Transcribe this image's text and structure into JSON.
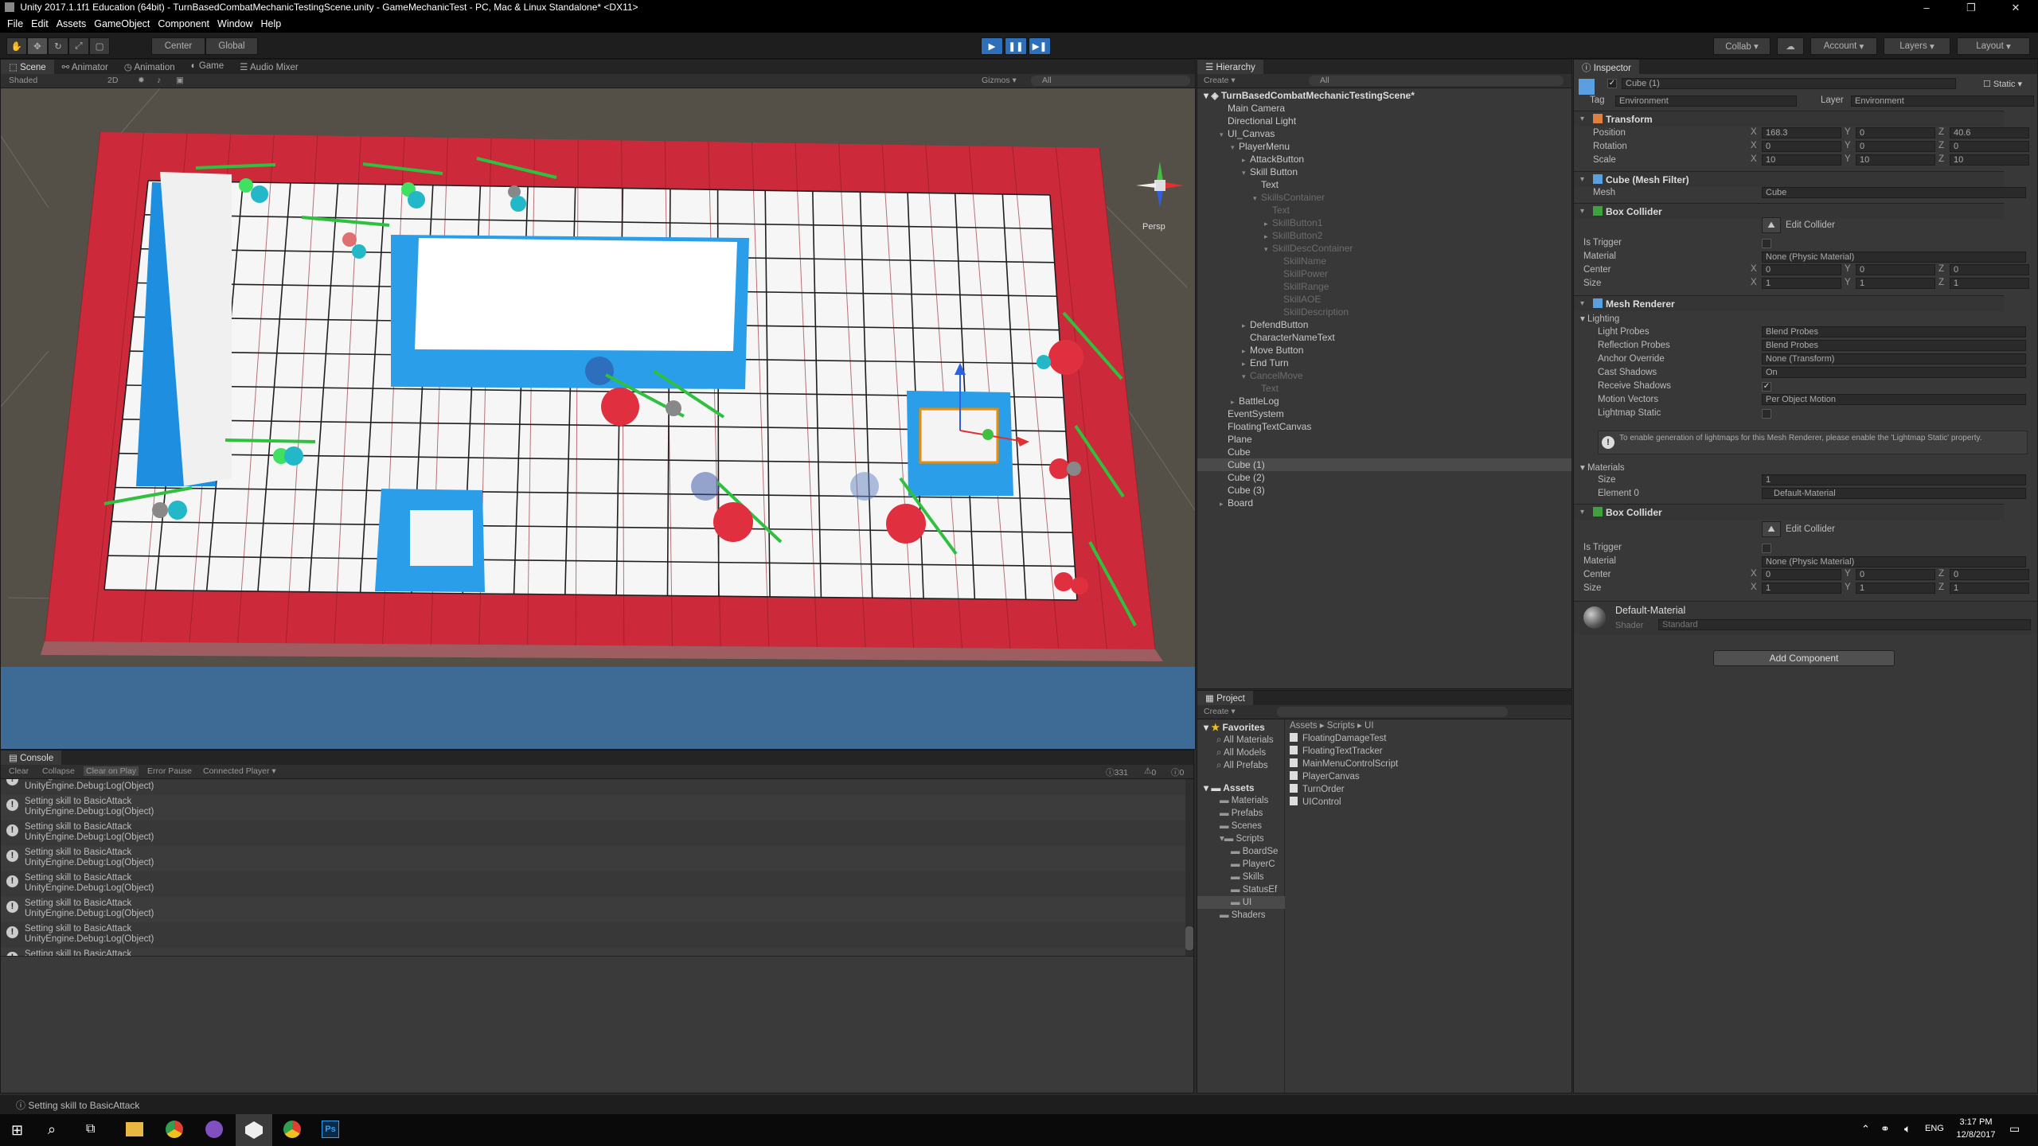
{
  "window": {
    "title": "Unity 2017.1.1f1 Education (64bit) - TurnBasedCombatMechanicTestingScene.unity - GameMechanicTest - PC, Mac & Linux Standalone* <DX11>",
    "controls": [
      "–",
      "❐",
      "✕"
    ]
  },
  "menu": [
    "File",
    "Edit",
    "Assets",
    "GameObject",
    "Component",
    "Window",
    "Help"
  ],
  "toolbar": {
    "center": "Center",
    "global": "Global",
    "collab": "Collab ▾",
    "account": "Account",
    "layers": "Layers",
    "layout": "Layout"
  },
  "scene": {
    "tabs": [
      "Scene",
      "Animator",
      "Animation",
      "Game",
      "Audio Mixer"
    ],
    "shading": "Shaded",
    "mode_2d": "2D",
    "gizmos": "Gizmos ▾",
    "search_placeholder": "All",
    "persp": "Persp"
  },
  "console": {
    "tab": "Console",
    "buttons": [
      "Clear",
      "Collapse",
      "Clear on Play",
      "Error Pause",
      "Connected Player ▾"
    ],
    "counts": {
      "logs": "331",
      "warnings": "0",
      "errors": "0"
    },
    "entries": [
      {
        "line1": "Setting skill to BasicAttack",
        "line2": "UnityEngine.Debug:Log(Object)"
      },
      {
        "line1": "Setting skill to BasicAttack",
        "line2": "UnityEngine.Debug:Log(Object)"
      },
      {
        "line1": "Setting skill to BasicAttack",
        "line2": "UnityEngine.Debug:Log(Object)"
      },
      {
        "line1": "Setting skill to BasicAttack",
        "line2": "UnityEngine.Debug:Log(Object)"
      },
      {
        "line1": "Setting skill to BasicAttack",
        "line2": "UnityEngine.Debug:Log(Object)"
      },
      {
        "line1": "Setting skill to BasicAttack",
        "line2": "UnityEngine.Debug:Log(Object)"
      },
      {
        "line1": "Setting skill to BasicAttack",
        "line2": "UnityEngine.Debug:Log(Object)"
      },
      {
        "line1": "Setting skill to BasicAttack",
        "line2": "UnityEngine.Debug:Log(Object)"
      },
      {
        "line1": "Setting skill to BasicAttack",
        "line2": "UnityEngine.Debug:Log(Object)"
      }
    ]
  },
  "hierarchy": {
    "tab": "Hierarchy",
    "create": "Create ▾",
    "search_placeholder": "All",
    "scene_name": "TurnBasedCombatMechanicTestingScene*",
    "items": [
      {
        "label": "Main Camera",
        "depth": 1,
        "state": "normal"
      },
      {
        "label": "Directional Light",
        "depth": 1,
        "state": "normal"
      },
      {
        "label": "UI_Canvas",
        "depth": 1,
        "state": "open"
      },
      {
        "label": "PlayerMenu",
        "depth": 2,
        "state": "open"
      },
      {
        "label": "AttackButton",
        "depth": 3,
        "state": "closed"
      },
      {
        "label": "Skill Button",
        "depth": 3,
        "state": "open"
      },
      {
        "label": "Text",
        "depth": 4,
        "state": "normal"
      },
      {
        "label": "SkillsContainer",
        "depth": 4,
        "state": "open-dim"
      },
      {
        "label": "Text",
        "depth": 5,
        "state": "dim"
      },
      {
        "label": "SkillButton1",
        "depth": 5,
        "state": "closed-dim"
      },
      {
        "label": "SkillButton2",
        "depth": 5,
        "state": "closed-dim"
      },
      {
        "label": "SkillDescContainer",
        "depth": 5,
        "state": "open-dim"
      },
      {
        "label": "SkillName",
        "depth": 6,
        "state": "dim"
      },
      {
        "label": "SkillPower",
        "depth": 6,
        "state": "dim"
      },
      {
        "label": "SkillRange",
        "depth": 6,
        "state": "dim"
      },
      {
        "label": "SkillAOE",
        "depth": 6,
        "state": "dim"
      },
      {
        "label": "SkillDescription",
        "depth": 6,
        "state": "dim"
      },
      {
        "label": "DefendButton",
        "depth": 3,
        "state": "closed"
      },
      {
        "label": "CharacterNameText",
        "depth": 3,
        "state": "normal"
      },
      {
        "label": "Move Button",
        "depth": 3,
        "state": "closed"
      },
      {
        "label": "End Turn",
        "depth": 3,
        "state": "closed"
      },
      {
        "label": "CancelMove",
        "depth": 3,
        "state": "open-dim"
      },
      {
        "label": "Text",
        "depth": 4,
        "state": "dim"
      },
      {
        "label": "BattleLog",
        "depth": 2,
        "state": "closed"
      },
      {
        "label": "EventSystem",
        "depth": 1,
        "state": "normal"
      },
      {
        "label": "FloatingTextCanvas",
        "depth": 1,
        "state": "normal"
      },
      {
        "label": "Plane",
        "depth": 1,
        "state": "normal"
      },
      {
        "label": "Cube",
        "depth": 1,
        "state": "normal"
      },
      {
        "label": "Cube (1)",
        "depth": 1,
        "state": "selected"
      },
      {
        "label": "Cube (2)",
        "depth": 1,
        "state": "normal"
      },
      {
        "label": "Cube (3)",
        "depth": 1,
        "state": "normal"
      },
      {
        "label": "Board",
        "depth": 1,
        "state": "closed"
      }
    ]
  },
  "project": {
    "tab": "Project",
    "create": "Create ▾",
    "breadcrumb": [
      "Assets",
      "Scripts",
      "UI"
    ],
    "favorites_label": "Favorites",
    "favorites": [
      "All Materials",
      "All Models",
      "All Prefabs"
    ],
    "assets_label": "Assets",
    "folders": [
      {
        "label": "Materials",
        "depth": 1
      },
      {
        "label": "Prefabs",
        "depth": 1
      },
      {
        "label": "Scenes",
        "depth": 1
      },
      {
        "label": "Scripts",
        "depth": 1
      },
      {
        "label": "BoardSe",
        "depth": 2
      },
      {
        "label": "PlayerC",
        "depth": 2
      },
      {
        "label": "Skills",
        "depth": 2
      },
      {
        "label": "StatusEf",
        "depth": 2
      },
      {
        "label": "UI",
        "depth": 2
      },
      {
        "label": "Shaders",
        "depth": 1
      }
    ],
    "files": [
      "FloatingDamageTest",
      "FloatingTextTracker",
      "MainMenuControlScript",
      "PlayerCanvas",
      "TurnOrder",
      "UIControl"
    ]
  },
  "inspector": {
    "tab": "Inspector",
    "object_name": "Cube (1)",
    "static_label": "Static ▾",
    "tag_label": "Tag",
    "tag_value": "Environment",
    "layer_label": "Layer",
    "layer_value": "Environment",
    "transform": {
      "title": "Transform",
      "position": {
        "label": "Position",
        "x": "168.3",
        "y": "0",
        "z": "40.6"
      },
      "rotation": {
        "label": "Rotation",
        "x": "0",
        "y": "0",
        "z": "0"
      },
      "scale": {
        "label": "Scale",
        "x": "10",
        "y": "10",
        "z": "10"
      }
    },
    "mesh_filter": {
      "title": "Cube (Mesh Filter)",
      "mesh_label": "Mesh",
      "mesh_value": "Cube"
    },
    "box_collider_1": {
      "title": "Box Collider",
      "edit": "Edit Collider",
      "is_trigger": "Is Trigger",
      "material_label": "Material",
      "material_value": "None (Physic Material)",
      "center": {
        "label": "Center",
        "x": "0",
        "y": "0",
        "z": "0"
      },
      "size": {
        "label": "Size",
        "x": "1",
        "y": "1",
        "z": "1"
      }
    },
    "mesh_renderer": {
      "title": "Mesh Renderer",
      "lighting": "Lighting",
      "light_probes": {
        "label": "Light Probes",
        "value": "Blend Probes"
      },
      "reflection_probes": {
        "label": "Reflection Probes",
        "value": "Blend Probes"
      },
      "anchor_override": {
        "label": "Anchor Override",
        "value": "None (Transform)"
      },
      "cast_shadows": {
        "label": "Cast Shadows",
        "value": "On"
      },
      "receive_shadows": "Receive Shadows",
      "motion_vectors": {
        "label": "Motion Vectors",
        "value": "Per Object Motion"
      },
      "lightmap_static": "Lightmap Static",
      "info": "To enable generation of lightmaps for this Mesh Renderer, please enable the 'Lightmap Static' property.",
      "materials": "Materials",
      "size": {
        "label": "Size",
        "value": "1"
      },
      "element0": {
        "label": "Element 0",
        "value": "Default-Material"
      }
    },
    "box_collider_2": {
      "title": "Box Collider",
      "edit": "Edit Collider",
      "is_trigger": "Is Trigger",
      "material_label": "Material",
      "material_value": "None (Physic Material)",
      "center": {
        "label": "Center",
        "x": "0",
        "y": "0",
        "z": "0"
      },
      "size": {
        "label": "Size",
        "x": "1",
        "y": "1",
        "z": "1"
      }
    },
    "material": {
      "name": "Default-Material",
      "shader_label": "Shader",
      "shader_value": "Standard"
    },
    "add_component": "Add Component"
  },
  "status": "Setting skill to BasicAttack",
  "taskbar": {
    "time": "3:17 PM",
    "date": "12/8/2017",
    "lang": "ENG"
  },
  "colors": {
    "board_red": "#d02c3c",
    "tile_white": "#f4f4f4",
    "water_blue": "#3e6a96",
    "unity_blue": "#2d6fb8",
    "health_green": "#30c040"
  }
}
